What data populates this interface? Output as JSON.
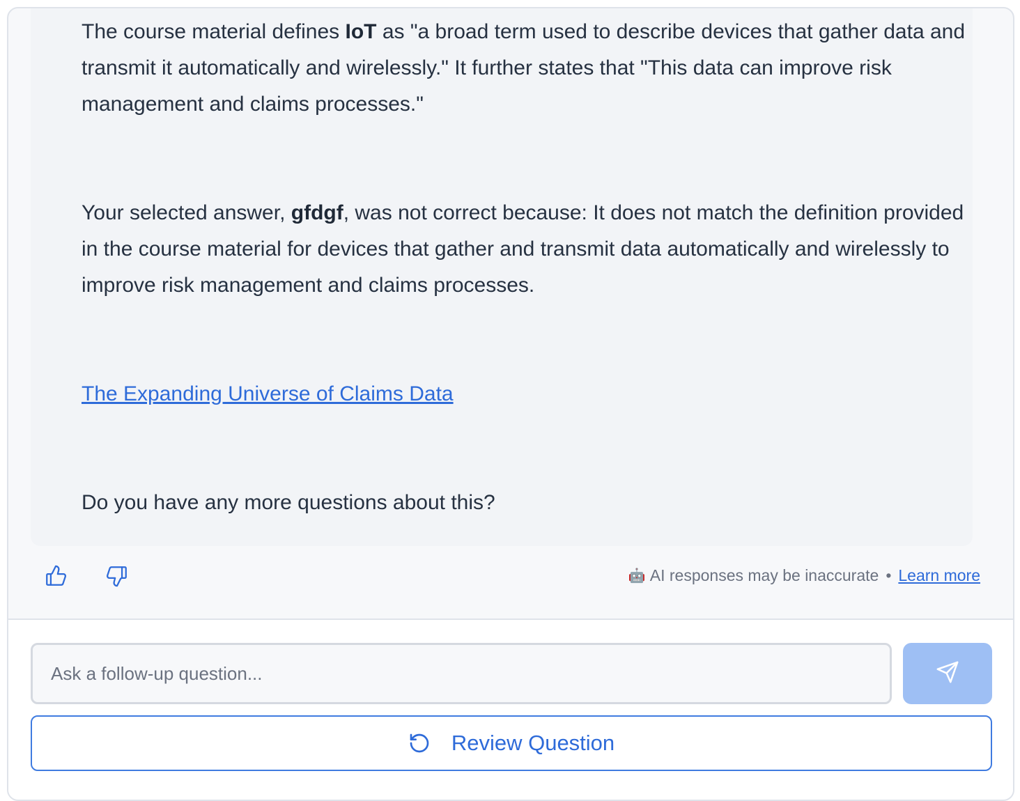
{
  "message": {
    "p1_pre": "The course material defines ",
    "p1_term": "IoT",
    "p1_post": " as \"a broad term used to describe devices that gather data and transmit it automatically and wirelessly.\" It further states that \"This data can improve risk management and claims processes.\"",
    "p2_pre": "Your selected answer, ",
    "p2_answer": "gfdgf",
    "p2_post": ", was not correct because: It does not match the definition provided in the course material for devices that gather and transmit data automatically and wirelessly to improve risk management and claims processes.",
    "source_link": "The Expanding Universe of Claims Data",
    "closing": "Do you have any more questions about this?"
  },
  "feedback": {
    "thumbs_up_icon": "thumbs-up-icon",
    "thumbs_down_icon": "thumbs-down-icon"
  },
  "disclaimer": {
    "icon": "robot-icon",
    "text": "AI responses may be inaccurate",
    "separator": "•",
    "link": "Learn more"
  },
  "composer": {
    "placeholder": "Ask a follow-up question...",
    "value": "",
    "send_icon": "send-icon"
  },
  "review": {
    "icon": "refresh-icon",
    "label": "Review Question"
  },
  "colors": {
    "accent": "#2e6bd9",
    "send_button": "#9ebff4",
    "message_bg": "#f2f4f7",
    "text": "#263141"
  }
}
